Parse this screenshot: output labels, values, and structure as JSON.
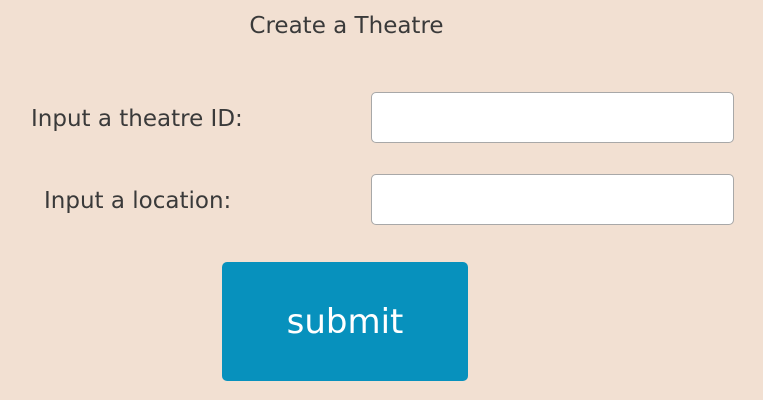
{
  "form": {
    "title": "Create a Theatre",
    "theatre_id": {
      "label": "Input a theatre ID:",
      "value": "",
      "placeholder": ""
    },
    "location": {
      "label": "Input a location:",
      "value": "",
      "placeholder": ""
    },
    "submit_label": "submit"
  },
  "colors": {
    "background": "#f2e0d2",
    "button": "#0791bd",
    "button_text": "#ffffff",
    "text": "#3a3a3a"
  }
}
